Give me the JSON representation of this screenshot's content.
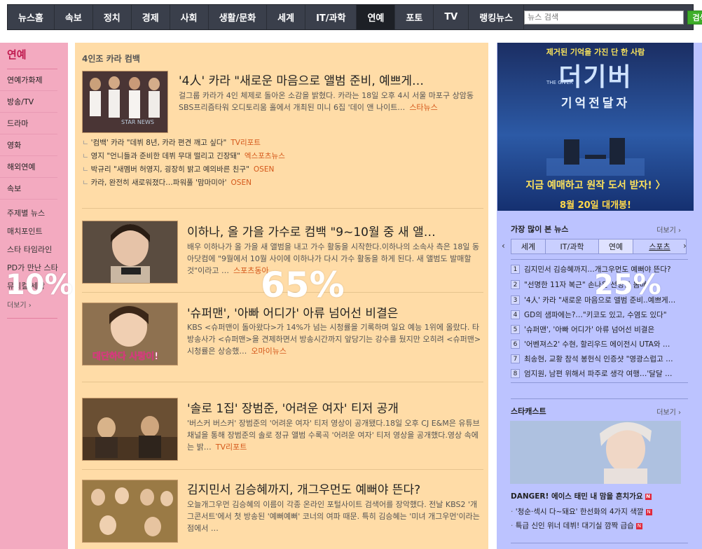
{
  "nav": {
    "items": [
      "뉴스홈",
      "속보",
      "정치",
      "경제",
      "사회",
      "생활/문화",
      "세계",
      "IT/과학",
      "연예",
      "포토",
      "TV",
      "랭킹뉴스"
    ],
    "active": "연예",
    "search_placeholder": "뉴스 검색",
    "search_button": "검색"
  },
  "left": {
    "title": "연예",
    "menu": [
      "연예가화제",
      "방송/TV",
      "드라마",
      "영화",
      "해외연예",
      "속보"
    ],
    "submenu": [
      "주제별 뉴스",
      "매치포인트",
      "스타 타임라인",
      "PD가 만난 스타",
      "뮤지컬 세상"
    ],
    "more": "더보기"
  },
  "center": {
    "section_title": "4인조 카라 컴백",
    "articles": [
      {
        "title": "'4人' 카라 \"새로운 마음으로 앨범 준비, 예쁘게…",
        "body": "걸그룹 카라가 4인 체제로 돌아온 소감을 밝혔다. 카라는 18일 오후 4시 서울 마포구 상암동 SBS프리즘타워 오디토리움 홀에서 개최된 미니 6집 '데이 앤 나이트…",
        "source": "스타뉴스"
      },
      {
        "title": "이하나, 올 가을 가수로 컴백 \"9~10월 중 새 앨…",
        "body": "배우 이하나가 올 가을 새 앨범을 내고 가수 활동을 시작한다.이하나의 소속사 측은 18일 동아닷컴에 \"9월에서 10월 사이에 이하나가 다시 가수 활동을 하게 된다. 새 앨범도 발매할 것\"이라고 …",
        "source": "스포츠동아"
      },
      {
        "title": "'슈퍼맨', '아빠 어디가' 아류 넘어선 비결은",
        "body": "KBS <슈퍼맨이 돌아왔다>가 14%가 넘는 시청률을 기록하며 일요 예능 1위에 올랐다. 타 방송사가 <슈퍼맨>을 견제하면서 방송시간까지 앞당기는 강수를 뒀지만 오히려 <슈퍼맨> 시청률은 상승했…",
        "source": "오마이뉴스"
      },
      {
        "title": "'솔로 1집' 장범준, '어려운 여자' 티저 공개",
        "body": "'버스커 버스커' 장범준의 '어려운 여자' 티저 영상이 공개됐다.18일 오후 CJ E&M은 유튜브 채널을 통해 장범준의 솔로 정규 앨범 수록곡 '어려운 여자' 티저 영상을 공개했다.영상 속에는 밝…",
        "source": "TV리포트"
      },
      {
        "title": "김지민서 김승혜까지, 개그우먼도 예뻐야 뜬다?",
        "body": "오늘개그우먼 김승혜의 이름이 각종 온라인 포털사이트 검색어를 장악했다. 전날 KBS2 '개그콘서트'에서 첫 방송된 '예뻐예뻐' 코너의 여파 때문. 특히 김승혜는 '미녀 개그우먼'이라는 점에서 …",
        "source": ""
      }
    ],
    "related": [
      {
        "text": "'컴백' 카라 \"데뷔 8년, 카라 편견 깨고 싶다\"",
        "source": "TV리포트"
      },
      {
        "text": "영지 \"언니들과 준비한 데뷔 무대 떨리고 긴장돼\"",
        "source": "엑스포츠뉴스"
      },
      {
        "text": "박규리 \"새멤버 허영지, 굉장히 밝고 예의바른 친구\"",
        "source": "OSEN"
      },
      {
        "text": "카라, 완전히 새로워졌다…파워풀 '맘마미아'",
        "source": "OSEN"
      }
    ],
    "thumb_captions": {
      "kara_sign": "STAR NEWS",
      "superman_text": "대단하다 사랑이!"
    }
  },
  "right": {
    "ad": {
      "tagline": "제거된 기억을 가진 단 한 사람",
      "title": "더기버",
      "title_en": "THE GIVER",
      "subtitle": "기억전달자",
      "cta": "지금 예매하고 원작 도서 받자! 〉",
      "date": "8월 20일 대개봉!"
    },
    "popular": {
      "title": "가장 많이 본 뉴스",
      "more": "더보기",
      "tabs": [
        "세계",
        "IT/과학",
        "연예",
        "스포츠"
      ],
      "active_tab": "연예",
      "items": [
        "김지민서 김승혜까지…개그우먼도 예뻐야 뜬다?",
        "\"선명한 11자 복근\" 손나은 선명한 몸매",
        "'4人' 카라 \"새로운 마음으로 앨범 준비..예쁘게…",
        "GD의 샘파에는?…\"키코도 있고, 수염도 있다\"",
        "'슈퍼맨', '아빠 어디가' 아류 넘어선 비결은",
        "'어벤져스2' 수현, 할리우드 에이전시 UTA와 …",
        "최송현, 교황 참석 봉헌식 인증샷 \"영광스럽고 …",
        "엄지원, 남편 위해서 파주로 생각 여행…'달달 …"
      ]
    },
    "starcast": {
      "title": "스타캐스트",
      "more": "더보기",
      "headline": "DANGER! 에이스 태민 내 맘을 흔치가요",
      "items": [
        "'청순·섹시 다~돼요' 한선화의 4가지 색깔",
        "특급 신인 위너 데뷔! 대기실 깜짝 급습"
      ]
    }
  },
  "overlay": {
    "left": "10%",
    "center": "65%",
    "right": "25%"
  },
  "colors": {
    "left_bg": "#f3aac0",
    "center_bg": "#ffdca7",
    "right_bg": "#bcc3ff",
    "nav_bg": "#3a3f4b",
    "source": "#d4571a"
  }
}
